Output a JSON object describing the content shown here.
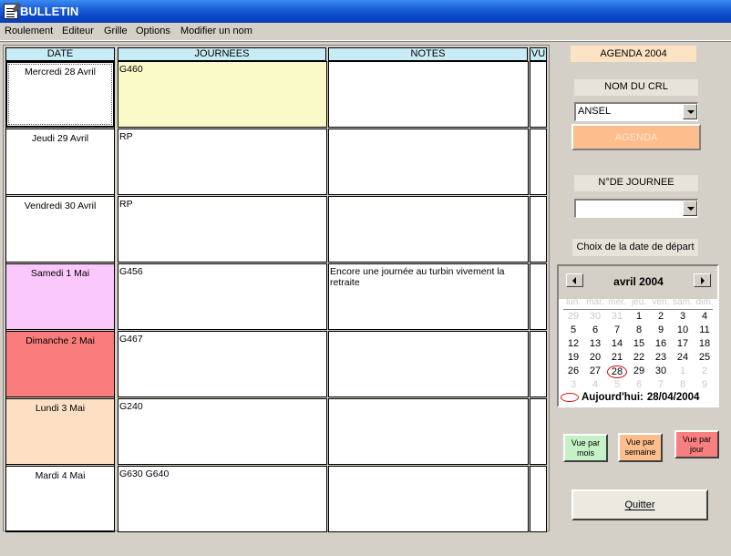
{
  "window": {
    "title": "BULLETIN"
  },
  "menu": [
    "Roulement",
    "Editeur",
    "Grille",
    "Options",
    "Modifier un nom"
  ],
  "grid": {
    "headers": {
      "date": "DATE",
      "journees": "JOURNEES",
      "notes": "NOTES",
      "vu": "VU"
    },
    "rows": [
      {
        "date": "Mercredi 28 Avril",
        "journee": "G460",
        "note": "",
        "date_color": "#ffffff",
        "journee_color": "#fafac8"
      },
      {
        "date": "Jeudi 29 Avril",
        "journee": "RP",
        "note": "",
        "date_color": "#ffffff",
        "journee_color": "#ffffff"
      },
      {
        "date": "Vendredi 30 Avril",
        "journee": "RP",
        "note": "",
        "date_color": "#ffffff",
        "journee_color": "#ffffff"
      },
      {
        "date": "Samedi 1 Mai",
        "journee": "G456",
        "note": "Encore une journée au turbin vivement la retraite",
        "date_color": "#fbc8fb",
        "journee_color": "#ffffff"
      },
      {
        "date": "Dimanche 2 Mai",
        "journee": "G467",
        "note": "",
        "date_color": "#fa7d7d",
        "journee_color": "#ffffff"
      },
      {
        "date": "Lundi 3 Mai",
        "journee": "G240",
        "note": "",
        "date_color": "#fde0c4",
        "journee_color": "#ffffff"
      },
      {
        "date": "Mardi 4 Mai",
        "journee": "G630 G640",
        "note": "",
        "date_color": "#ffffff",
        "journee_color": "#ffffff"
      }
    ]
  },
  "side": {
    "agenda_year": "AGENDA 2004",
    "crl_label": "NOM DU CRL",
    "crl_value": "ANSEL",
    "agenda_button": "AGENDA",
    "journee_label": "N°DE JOURNEE",
    "journee_value": "",
    "date_choice_label": "Choix de la date de départ"
  },
  "calendar": {
    "month_label": "avril 2004",
    "weekdays": [
      "lun.",
      "mar.",
      "mer.",
      "jeu.",
      "ven.",
      "sam.",
      "dim."
    ],
    "weeks": [
      [
        "29",
        "30",
        "31",
        "1",
        "2",
        "3",
        "4"
      ],
      [
        "5",
        "6",
        "7",
        "8",
        "9",
        "10",
        "11"
      ],
      [
        "12",
        "13",
        "14",
        "15",
        "16",
        "17",
        "18"
      ],
      [
        "19",
        "20",
        "21",
        "22",
        "23",
        "24",
        "25"
      ],
      [
        "26",
        "27",
        "28",
        "29",
        "30",
        "1",
        "2"
      ],
      [
        "3",
        "4",
        "5",
        "6",
        "7",
        "8",
        "9"
      ]
    ],
    "other_month_flags": [
      [
        true,
        true,
        true,
        false,
        false,
        false,
        false
      ],
      [
        false,
        false,
        false,
        false,
        false,
        false,
        false
      ],
      [
        false,
        false,
        false,
        false,
        false,
        false,
        false
      ],
      [
        false,
        false,
        false,
        false,
        false,
        false,
        false
      ],
      [
        false,
        false,
        false,
        false,
        false,
        true,
        true
      ],
      [
        true,
        true,
        true,
        true,
        true,
        true,
        true
      ]
    ],
    "selected_day": "28",
    "today_label": "Aujourd'hui:",
    "today_value": "28/04/2004"
  },
  "view_buttons": [
    {
      "label": "Vue par mois",
      "color": "#c4f2c4"
    },
    {
      "label": "Vue par semaine",
      "color": "#fdbd8c"
    },
    {
      "label": "Vue par jour",
      "color": "#f77f7f"
    }
  ],
  "quit_button": "Quitter"
}
